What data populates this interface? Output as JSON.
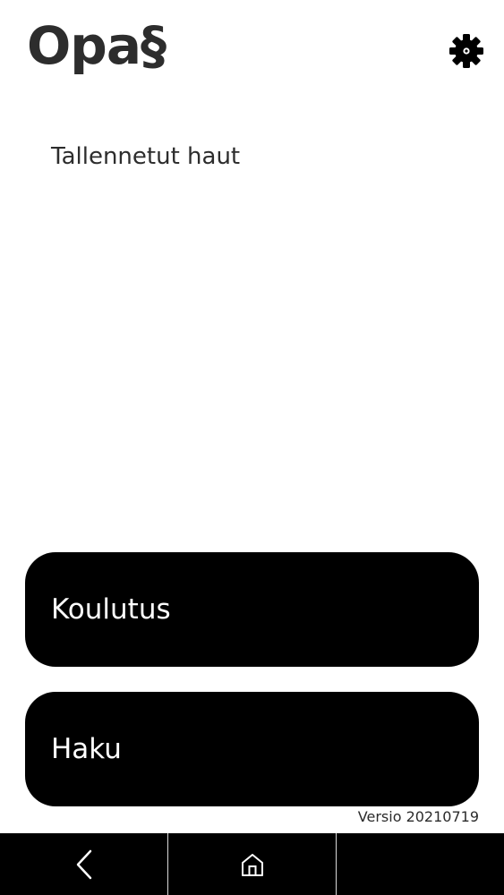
{
  "app": {
    "logo_text": "Opa§"
  },
  "header": {
    "settings_icon": "gear-icon"
  },
  "main": {
    "saved_searches_label": "Tallennetut haut",
    "buttons": [
      {
        "label": "Koulutus"
      },
      {
        "label": "Haku"
      }
    ],
    "version_text": "Versio 20210719"
  },
  "navbar": {
    "items": [
      {
        "icon": "back-arrow-icon"
      },
      {
        "icon": "home-icon"
      },
      {
        "icon": ""
      }
    ]
  },
  "colors": {
    "background": "#ffffff",
    "button_bg": "#000000",
    "button_text": "#ffffff",
    "text": "#2d2d2d",
    "navbar_bg": "#000000"
  }
}
